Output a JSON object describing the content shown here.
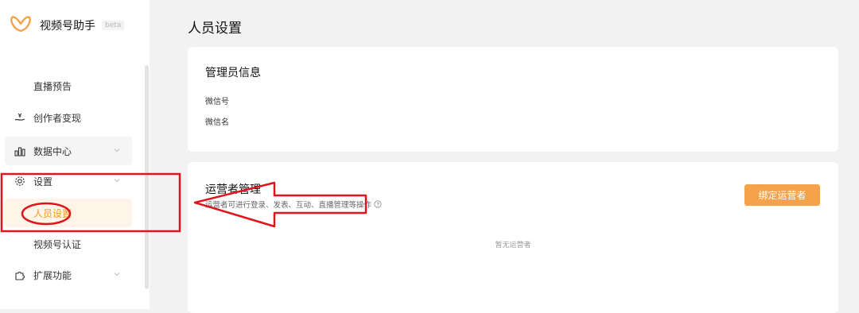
{
  "app": {
    "title": "视频号助手",
    "badge": "beta"
  },
  "sidebar": {
    "items": [
      {
        "label": "直播预告"
      },
      {
        "label": "创作者变现"
      },
      {
        "label": "数据中心"
      },
      {
        "label": "设置"
      },
      {
        "label": "人员设置"
      },
      {
        "label": "视频号认证"
      },
      {
        "label": "扩展功能"
      }
    ]
  },
  "page": {
    "title": "人员设置"
  },
  "admin_card": {
    "title": "管理员信息",
    "fields": [
      {
        "label": "微信号"
      },
      {
        "label": "微信名"
      }
    ]
  },
  "operator_card": {
    "title": "运营者管理",
    "description": "运营者可进行登录、发表、互动、直播管理等操作",
    "bind_button": "绑定运营者",
    "empty_text": "暂无运营者"
  },
  "colors": {
    "accent": "#f5a24a",
    "annotation": "#e0141c"
  },
  "icons": [
    "logo-icon",
    "hand-coin-icon",
    "bar-chart-icon",
    "gear-icon",
    "puzzle-icon",
    "chevron-down-icon",
    "help-icon"
  ]
}
